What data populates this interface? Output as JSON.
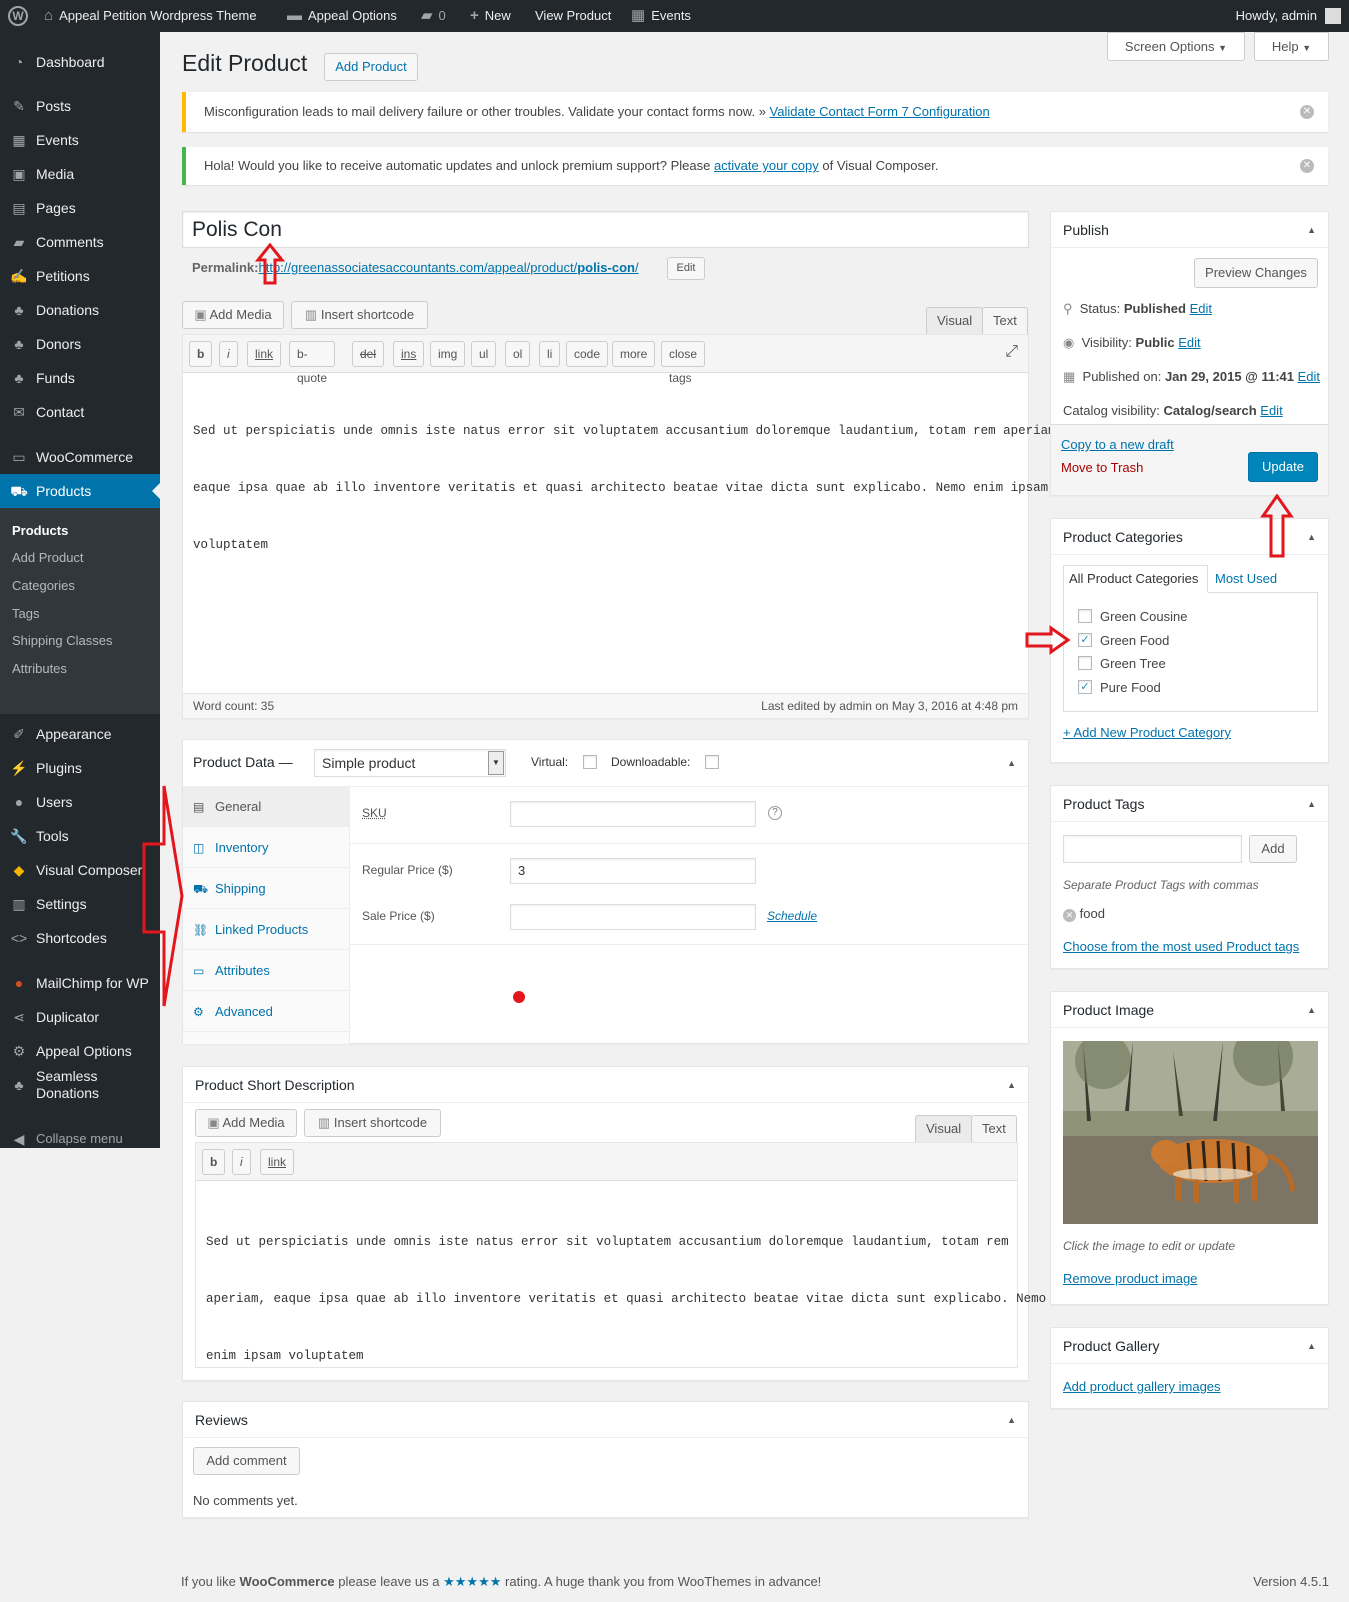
{
  "adminbar": {
    "site_name": "Appeal Petition Wordpress Theme",
    "options": "Appeal Options",
    "comments_count": "0",
    "new": "New",
    "view_product": "View Product",
    "events": "Events",
    "howdy": "Howdy, admin"
  },
  "sidebar": {
    "items": [
      {
        "label": "Dashboard",
        "icon": "dashboard-icon"
      },
      {
        "label": "Posts",
        "icon": "pin-icon"
      },
      {
        "label": "Events",
        "icon": "calendar-icon"
      },
      {
        "label": "Media",
        "icon": "media-icon"
      },
      {
        "label": "Pages",
        "icon": "page-icon"
      },
      {
        "label": "Comments",
        "icon": "comment-icon"
      },
      {
        "label": "Petitions",
        "icon": "petition-icon"
      },
      {
        "label": "Donations",
        "icon": "palm-icon"
      },
      {
        "label": "Donors",
        "icon": "palm-icon"
      },
      {
        "label": "Funds",
        "icon": "palm-icon"
      },
      {
        "label": "Contact",
        "icon": "mail-icon"
      },
      {
        "label": "WooCommerce",
        "icon": "woo-icon"
      },
      {
        "label": "Products",
        "icon": "cart-icon"
      },
      {
        "label": "Appearance",
        "icon": "brush-icon"
      },
      {
        "label": "Plugins",
        "icon": "plugin-icon"
      },
      {
        "label": "Users",
        "icon": "user-icon"
      },
      {
        "label": "Tools",
        "icon": "wrench-icon"
      },
      {
        "label": "Visual Composer",
        "icon": "vc-icon"
      },
      {
        "label": "Settings",
        "icon": "settings-icon"
      },
      {
        "label": "Shortcodes",
        "icon": "code-icon"
      },
      {
        "label": "MailChimp for WP",
        "icon": "mailchimp-icon"
      },
      {
        "label": "Duplicator",
        "icon": "share-icon"
      },
      {
        "label": "Appeal Options",
        "icon": "gear-icon"
      },
      {
        "label": "Seamless",
        "label2": "Donations",
        "icon": "palm-icon"
      }
    ],
    "submenu": [
      "Products",
      "Add Product",
      "Categories",
      "Tags",
      "Shipping Classes",
      "Attributes"
    ],
    "collapse": "Collapse menu"
  },
  "header": {
    "title": "Edit Product",
    "add_button": "Add Product",
    "screen_options": "Screen Options",
    "help": "Help"
  },
  "notices": {
    "cf7_text": "Misconfiguration leads to mail delivery failure or other troubles. Validate your contact forms now. »",
    "cf7_link": "Validate Contact Form 7 Configuration",
    "vc_text1": "Hola! Would you like to receive automatic updates and unlock premium support? Please",
    "vc_link": "activate your copy",
    "vc_text2": "of Visual Composer."
  },
  "post": {
    "title": "Polis Con",
    "permalink_label": "Permalink:",
    "permalink_url": "http://greenassociatesaccountants.com/appeal/product/",
    "permalink_slug": "polis-con",
    "permalink_end": "/",
    "edit_btn": "Edit"
  },
  "editor": {
    "add_media": "Add Media",
    "insert_shortcode": "Insert shortcode",
    "tab_visual": "Visual",
    "tab_text": "Text",
    "quicktags": [
      "b",
      "i",
      "link",
      "b-quote",
      "del",
      "ins",
      "img",
      "ul",
      "ol",
      "li",
      "code",
      "more",
      "close tags"
    ],
    "content_lines": [
      "Sed ut perspiciatis unde omnis iste natus error sit voluptatem accusantium doloremque laudantium, totam rem aperiam,",
      "eaque ipsa quae ab illo inventore veritatis et quasi architecto beatae vitae dicta sunt explicabo. Nemo enim ipsam",
      "voluptatem"
    ],
    "word_count": "Word count: 35",
    "last_edited": "Last edited by admin on May 3, 2016 at 4:48 pm"
  },
  "product_data": {
    "title": "Product Data —",
    "type_selected": "Simple product",
    "virtual_label": "Virtual:",
    "downloadable_label": "Downloadable:",
    "tabs": [
      "General",
      "Inventory",
      "Shipping",
      "Linked Products",
      "Attributes",
      "Advanced"
    ],
    "sku_label": "SKU",
    "sku_value": "",
    "regular_price_label": "Regular Price ($)",
    "regular_price_value": "3",
    "sale_price_label": "Sale Price ($)",
    "sale_price_value": "",
    "schedule": "Schedule",
    "help_icon": "?"
  },
  "short_desc": {
    "title": "Product Short Description",
    "add_media": "Add Media",
    "insert_shortcode": "Insert shortcode",
    "tab_visual": "Visual",
    "tab_text": "Text",
    "quicktags": [
      "b",
      "i",
      "link"
    ],
    "content_lines": [
      "Sed ut perspiciatis unde omnis iste natus error sit voluptatem accusantium doloremque laudantium, totam rem",
      "aperiam, eaque ipsa quae ab illo inventore veritatis et quasi architecto beatae vitae dicta sunt explicabo. Nemo",
      "enim ipsam voluptatem"
    ]
  },
  "reviews": {
    "title": "Reviews",
    "add_comment": "Add comment",
    "no_comments": "No comments yet."
  },
  "publish": {
    "title": "Publish",
    "preview": "Preview Changes",
    "status_label": "Status:",
    "status_value": "Published",
    "visibility_label": "Visibility:",
    "visibility_value": "Public",
    "published_label": "Published on:",
    "published_value": "Jan 29, 2015 @ 11:41",
    "catalog_label": "Catalog visibility:",
    "catalog_value": "Catalog/search",
    "edit": "Edit",
    "copy_draft": "Copy to a new draft",
    "trash": "Move to Trash",
    "update": "Update"
  },
  "categories": {
    "title": "Product Categories",
    "tab_all": "All Product Categories",
    "tab_most": "Most Used",
    "items": [
      {
        "label": "Green Cousine",
        "checked": false
      },
      {
        "label": "Green Food",
        "checked": true
      },
      {
        "label": "Green Tree",
        "checked": false
      },
      {
        "label": "Pure Food",
        "checked": true
      }
    ],
    "add_new": "+ Add New Product Category"
  },
  "tags": {
    "title": "Product Tags",
    "input_value": "",
    "add": "Add",
    "hint": "Separate Product Tags with commas",
    "tag": "food",
    "choose": "Choose from the most used Product tags"
  },
  "product_image": {
    "title": "Product Image",
    "hint": "Click the image to edit or update",
    "remove": "Remove product image"
  },
  "gallery": {
    "title": "Product Gallery",
    "add": "Add product gallery images"
  },
  "footer": {
    "text1": "If you like",
    "brand": "WooCommerce",
    "text2": "please leave us a",
    "stars": "★★★★★",
    "text3": "rating. A huge thank you from WooThemes in advance!",
    "version": "Version 4.5.1"
  },
  "colors": {
    "accent": "#0073aa",
    "primary_button": "#0085ba",
    "sidebar_bg": "#23282d",
    "annotation_red": "#e3161e"
  }
}
